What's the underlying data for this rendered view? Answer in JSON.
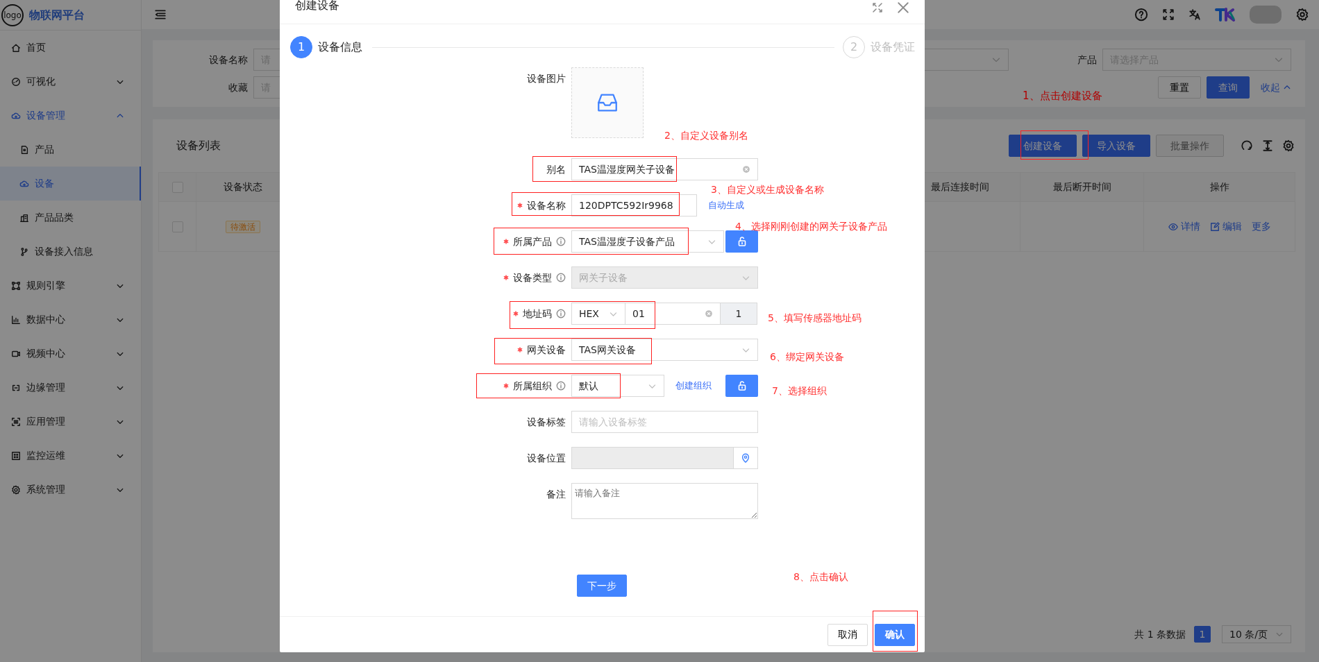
{
  "sidebar": {
    "logo_text": "logo",
    "title": "物联网平台",
    "items": [
      {
        "label": "首页",
        "kind": "link",
        "selected": false
      },
      {
        "label": "可视化",
        "kind": "group",
        "expanded": false,
        "selected": false
      },
      {
        "label": "设备管理",
        "kind": "group",
        "expanded": true,
        "selected": false,
        "children": [
          {
            "label": "产品",
            "selected": false
          },
          {
            "label": "设备",
            "selected": true
          },
          {
            "label": "产品品类",
            "selected": false
          },
          {
            "label": "设备接入信息",
            "selected": false
          }
        ]
      },
      {
        "label": "规则引擎",
        "kind": "group",
        "expanded": false,
        "selected": false
      },
      {
        "label": "数据中心",
        "kind": "group",
        "expanded": false,
        "selected": false
      },
      {
        "label": "视频中心",
        "kind": "group",
        "expanded": false,
        "selected": false
      },
      {
        "label": "边缘管理",
        "kind": "group",
        "expanded": false,
        "selected": false
      },
      {
        "label": "应用管理",
        "kind": "group",
        "expanded": false,
        "selected": false
      },
      {
        "label": "监控运维",
        "kind": "group",
        "expanded": false,
        "selected": false
      },
      {
        "label": "系统管理",
        "kind": "group",
        "expanded": false,
        "selected": false
      }
    ]
  },
  "filters": {
    "fields": [
      {
        "label": "设备名称",
        "placeholder": "请"
      },
      {
        "label": "收藏",
        "placeholder": "请"
      },
      {
        "label": "产品",
        "placeholder": "请选择产品"
      }
    ],
    "buttons": [
      {
        "label": "重置",
        "kind": "default"
      },
      {
        "label": "查询",
        "kind": "primary"
      },
      {
        "label": "收起",
        "kind": "link"
      }
    ]
  },
  "device_list": {
    "title": "设备列表",
    "buttons": [
      {
        "label": "创建设备",
        "kind": "primary",
        "disabled": false
      },
      {
        "label": "导入设备",
        "kind": "primary",
        "disabled": false
      },
      {
        "label": "批量操作",
        "kind": "default",
        "disabled": true
      }
    ],
    "table": {
      "header_checked": false,
      "columns": [
        "设备状态",
        "最后连接时间",
        "最后断开时间",
        "操作"
      ],
      "rows": [
        {
          "checked": false,
          "status": "待激活",
          "actions": [
            "详情",
            "编辑",
            "更多"
          ]
        }
      ]
    },
    "pagination": {
      "total": "共 1 条数据",
      "pages": [
        {
          "label": "1",
          "selected": true
        }
      ],
      "page_size": "10 条/页"
    }
  },
  "dialog": {
    "title": "创建设备",
    "steps": [
      {
        "number": "1",
        "label": "设备信息",
        "selected": true
      },
      {
        "number": "2",
        "label": "设备凭证",
        "selected": false
      }
    ],
    "fields": [
      {
        "kind": "image",
        "label": "设备图片"
      },
      {
        "kind": "input",
        "label": "别名",
        "value": "TAS温湿度网关子设备",
        "clearable": true
      },
      {
        "kind": "input",
        "label": "设备名称",
        "required": true,
        "value": "120DPTC592Ir9968",
        "link": "自动生成"
      },
      {
        "kind": "select",
        "label": "所属产品",
        "required": true,
        "info": true,
        "value": "TAS温湿度子设备产品",
        "lock_button": true
      },
      {
        "kind": "select",
        "label": "设备类型",
        "required": true,
        "info": true,
        "disabled": true,
        "value": "网关子设备"
      },
      {
        "kind": "address",
        "label": "地址码",
        "required": true,
        "info": true,
        "prefix": "HEX",
        "value": "01",
        "suffix": "1",
        "clearable": true
      },
      {
        "kind": "select",
        "label": "网关设备",
        "required": true,
        "value": "TAS网关设备"
      },
      {
        "kind": "select",
        "label": "所属组织",
        "required": true,
        "info": true,
        "value": "默认",
        "link": "创建组织",
        "lock_button": true
      },
      {
        "kind": "input",
        "label": "设备标签",
        "placeholder": "请输入设备标签"
      },
      {
        "kind": "location",
        "label": "设备位置",
        "disabled": true
      },
      {
        "kind": "textarea",
        "label": "备注",
        "placeholder": "请输入备注"
      }
    ],
    "next_button": "下一步",
    "footer_buttons": [
      {
        "label": "取消",
        "kind": "default"
      },
      {
        "label": "确认",
        "kind": "primary"
      }
    ]
  },
  "annotations": [
    "1、点击创建设备",
    "2、自定义设备别名",
    "3、自定义或生成设备名称",
    "4、选择刚刚创建的网关子设备产品",
    "5、填写传感器地址码",
    "6、绑定网关设备",
    "7、选择组织",
    "8、点击确认"
  ]
}
